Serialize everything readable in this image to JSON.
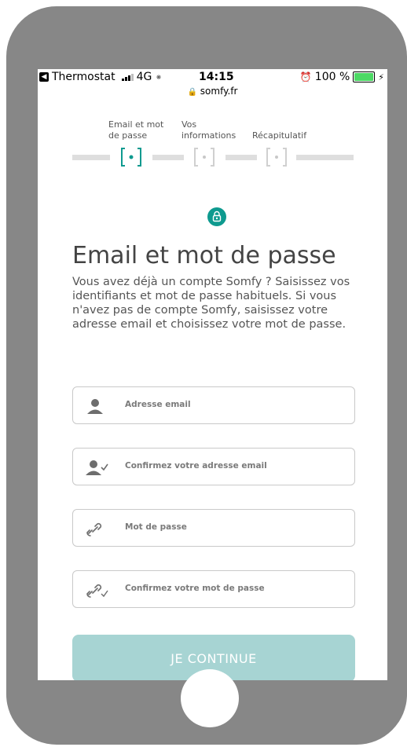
{
  "status_bar": {
    "back_app": "Thermostat",
    "network": "4G",
    "time": "14:15",
    "battery": "100 %",
    "url": "somfy.fr"
  },
  "steps": [
    {
      "label_line1": "Email et mot",
      "label_line2": "de passe",
      "active": true
    },
    {
      "label_line1": "Vos",
      "label_line2": "informations",
      "active": false
    },
    {
      "label_line1": "",
      "label_line2": "Récapitulatif",
      "active": false
    }
  ],
  "page": {
    "title": "Email et mot de passe",
    "description": "Vous avez déjà un compte Somfy ? Saisissez vos identifiants et mot de passe habituels. Si vous n'avez pas de compte Somfy, saisissez votre adresse email et choisissez votre mot de passe."
  },
  "form": {
    "email_placeholder": "Adresse email",
    "confirm_email_placeholder": "Confirmez votre adresse email",
    "password_placeholder": "Mot de passe",
    "confirm_password_placeholder": "Confirmez votre mot de passe",
    "submit_label": "JE CONTINUE"
  },
  "colors": {
    "accent": "#0e9a8f",
    "button_bg": "#a7d4d3",
    "frame": "#878787"
  }
}
